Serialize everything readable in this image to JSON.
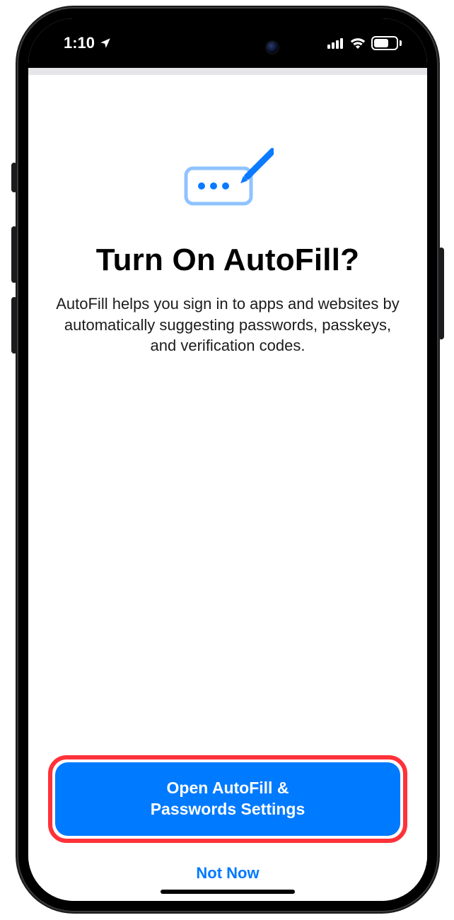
{
  "status": {
    "time": "1:10",
    "battery_percent": "58"
  },
  "sheet": {
    "title": "Turn On AutoFill?",
    "description": "AutoFill helps you sign in to apps and websites by automatically suggesting passwords, passkeys, and verification codes.",
    "primary_button": "Open AutoFill &\nPasswords Settings",
    "secondary_button": "Not Now"
  }
}
